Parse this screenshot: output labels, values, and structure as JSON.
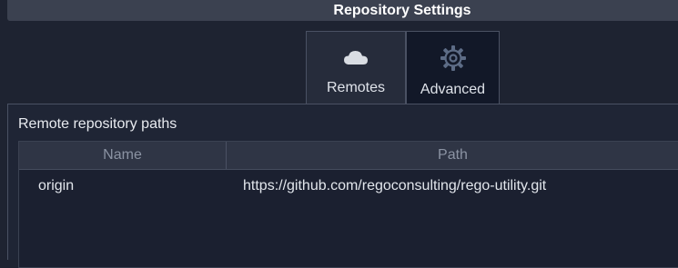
{
  "window": {
    "title": "Repository Settings"
  },
  "tabs": [
    {
      "label": "Remotes",
      "icon": "cloud-icon",
      "selected": true
    },
    {
      "label": "Advanced",
      "icon": "gear-icon",
      "selected": false
    }
  ],
  "remotes": {
    "group_label": "Remote repository paths",
    "columns": [
      "Name",
      "Path"
    ],
    "rows": [
      {
        "name": "origin",
        "path": "https://github.com/regoconsulting/rego-utility.git"
      }
    ]
  },
  "colors": {
    "background": "#1e2331",
    "title_bar": "#3b4150",
    "selected_tab": "#262c3b",
    "unselected_tab": "#121828",
    "table_header": "#2f3545"
  }
}
